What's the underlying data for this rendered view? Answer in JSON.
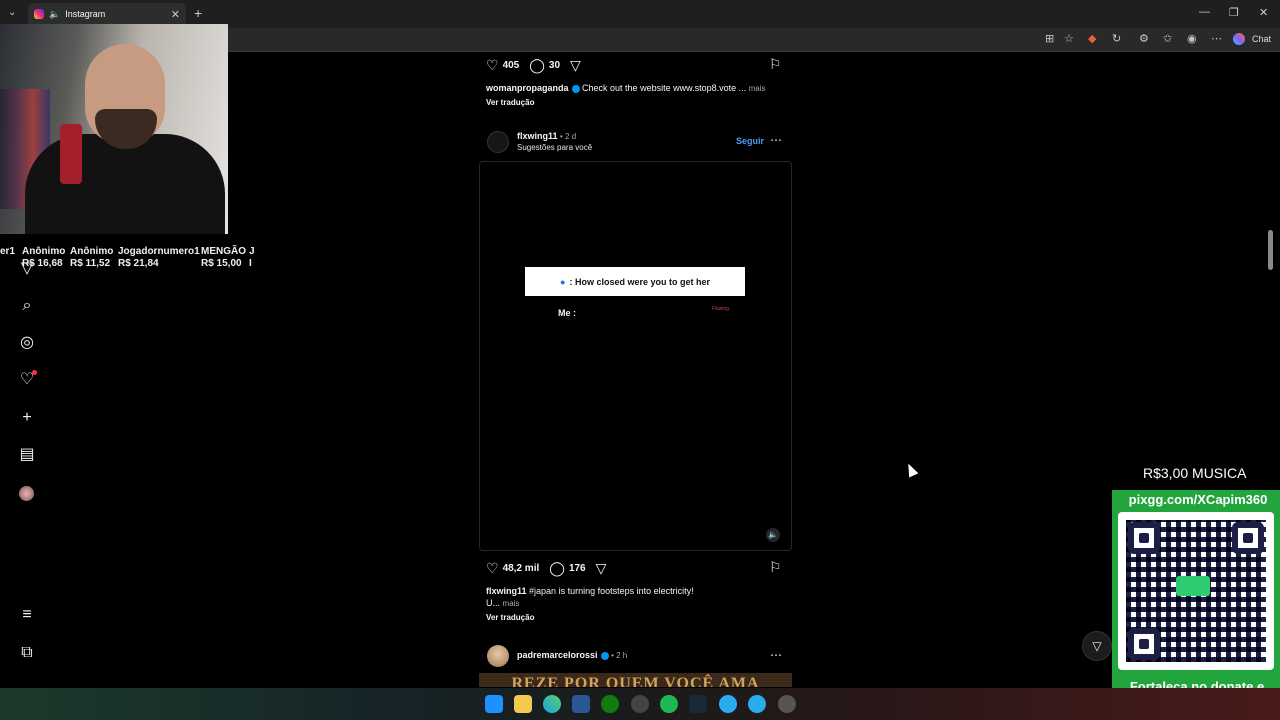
{
  "browser": {
    "tab_title": "Instagram",
    "chat_label": "Chat"
  },
  "donors": [
    {
      "name": "er1",
      "amount": ""
    },
    {
      "name": "Anônimo",
      "amount": "R$ 16,68"
    },
    {
      "name": "Anônimo",
      "amount": "R$ 11,52"
    },
    {
      "name": "Jogadornumero1",
      "amount": "R$ 21,84"
    },
    {
      "name": "MENGÃO",
      "amount": "R$ 15,00"
    },
    {
      "name": "J",
      "amount": "I"
    }
  ],
  "post_top": {
    "likes": "405",
    "comments": "30",
    "username": "womanpropaganda",
    "caption": "Check out the website www.stop8.vote ...",
    "more": "mais",
    "translate": "Ver tradução"
  },
  "post_main": {
    "username": "flxwing11",
    "time": "• 2 d",
    "subtitle": "Sugestões para você",
    "follow": "Seguir",
    "meme_question": ": How closed were you to get her",
    "meme_me": "Me :",
    "watermark": "Flxwing",
    "likes": "48,2 mil",
    "comments": "176",
    "caption_user": "flxwing11",
    "hashtag": "#japan",
    "caption": "is turning footsteps into electricity!",
    "caption_line2": "U...",
    "more": "mais",
    "translate": "Ver tradução"
  },
  "post_next": {
    "username": "padremarcelorossi",
    "time": "• 2 h",
    "banner_text": "REZE POR QUEM VOCÊ AMA"
  },
  "overlay": {
    "music": "R$3,00 MUSICA",
    "qr_url": "pixgg.com/XCapim360",
    "message": "Fortaleça no donate e envie sua mensagem!"
  }
}
